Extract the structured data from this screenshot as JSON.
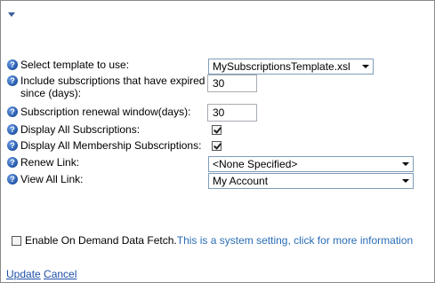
{
  "form": {
    "template_label": "Select template to use:",
    "template_value": "MySubscriptionsTemplate.xsl",
    "expired_label": "Include subscriptions that have expired since (days):",
    "expired_value": "30",
    "renewal_label": "Subscription renewal window(days):",
    "renewal_value": "30",
    "display_all_label": "Display All Subscriptions:",
    "display_all_checked": true,
    "display_membership_label": "Display All Membership Subscriptions:",
    "display_membership_checked": true,
    "renew_link_label": "Renew Link:",
    "renew_link_value": "<None Specified>",
    "view_all_label": "View All Link:",
    "view_all_value": "My Account"
  },
  "on_demand": {
    "label": "Enable On Demand Data Fetch.",
    "info": "This is a system setting, click for more information",
    "checked": false
  },
  "actions": {
    "update": "Update",
    "cancel": "Cancel"
  },
  "icons": {
    "help": "help-icon",
    "collapse": "collapse-arrow-icon"
  },
  "colors": {
    "link": "#1f4fa8",
    "info_text": "#2a6db5",
    "help_icon": "#2c5fb0"
  }
}
